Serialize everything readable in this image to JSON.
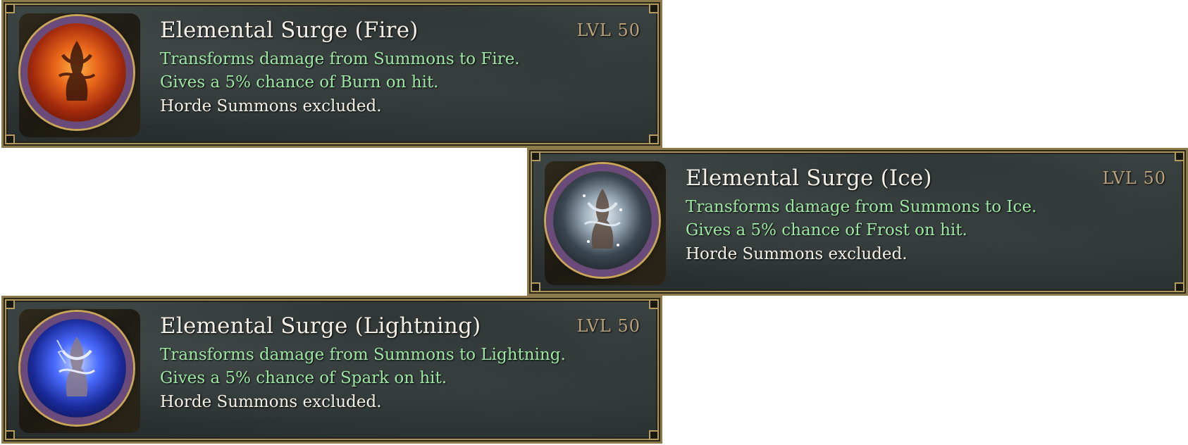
{
  "cards": [
    {
      "title": "Elemental Surge (Fire)",
      "level": "LVL 50",
      "lines": [
        "Transforms damage from Summons to Fire.",
        "Gives a 5% chance of Burn on hit.",
        "Horde Summons excluded."
      ],
      "icon": "fire-summon-icon",
      "accent": "#e8651a"
    },
    {
      "title": "Elemental Surge (Ice)",
      "level": "LVL 50",
      "lines": [
        "Transforms damage from Summons to Ice.",
        "Gives a 5% chance of Frost on hit.",
        "Horde Summons excluded."
      ],
      "icon": "ice-summon-icon",
      "accent": "#9fb0bd"
    },
    {
      "title": "Elemental Surge (Lightning)",
      "level": "LVL 50",
      "lines": [
        "Transforms damage from Summons to Lightning.",
        "Gives a 5% chance of Spark on hit.",
        "Horde Summons excluded."
      ],
      "icon": "lightning-summon-icon",
      "accent": "#4a6cff"
    }
  ],
  "colors": {
    "effect_text": "#9ee6a4",
    "plain_text": "#f4f0e6",
    "level_text": "#b9a27a",
    "frame_gold": "#8d7a4a"
  }
}
